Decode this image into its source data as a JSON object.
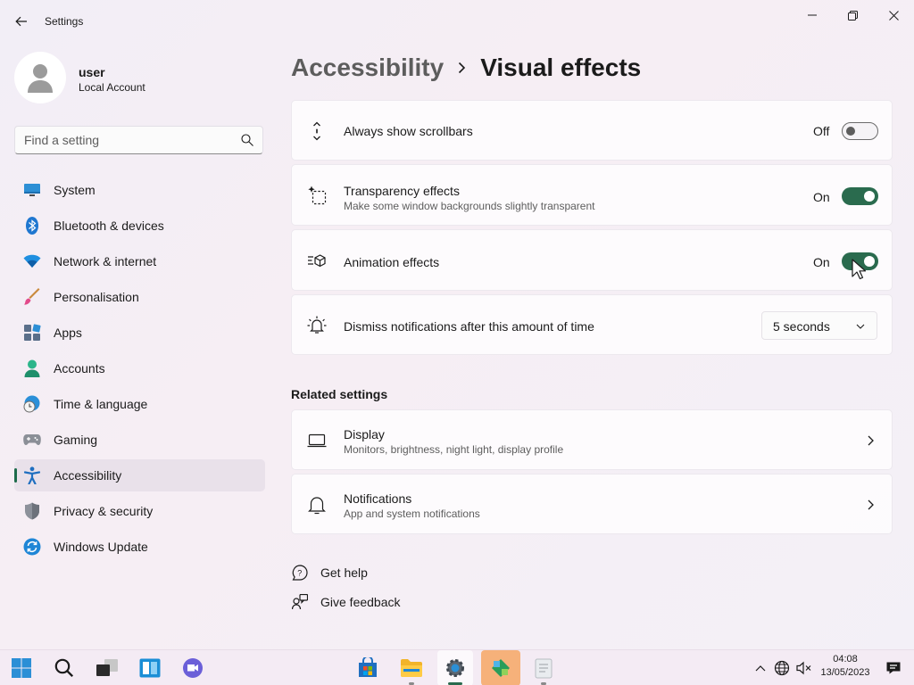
{
  "window": {
    "title": "Settings"
  },
  "profile": {
    "name": "user",
    "account_type": "Local Account"
  },
  "search": {
    "placeholder": "Find a setting"
  },
  "nav": {
    "items": [
      {
        "label": "System",
        "icon": "monitor-icon"
      },
      {
        "label": "Bluetooth & devices",
        "icon": "bluetooth-icon"
      },
      {
        "label": "Network & internet",
        "icon": "wifi-icon"
      },
      {
        "label": "Personalisation",
        "icon": "brush-icon"
      },
      {
        "label": "Apps",
        "icon": "apps-icon"
      },
      {
        "label": "Accounts",
        "icon": "person-icon"
      },
      {
        "label": "Time & language",
        "icon": "globe-clock-icon"
      },
      {
        "label": "Gaming",
        "icon": "gamepad-icon"
      },
      {
        "label": "Accessibility",
        "icon": "accessibility-icon",
        "selected": true
      },
      {
        "label": "Privacy & security",
        "icon": "shield-icon"
      },
      {
        "label": "Windows Update",
        "icon": "update-icon"
      }
    ]
  },
  "breadcrumb": {
    "parent": "Accessibility",
    "current": "Visual effects"
  },
  "settings": {
    "scrollbars": {
      "title": "Always show scrollbars",
      "state_label": "Off",
      "enabled": false
    },
    "transparency": {
      "title": "Transparency effects",
      "subtitle": "Make some window backgrounds slightly transparent",
      "state_label": "On",
      "enabled": true
    },
    "animation": {
      "title": "Animation effects",
      "state_label": "On",
      "enabled": true
    },
    "notifications_timeout": {
      "title": "Dismiss notifications after this amount of time",
      "selected": "5 seconds"
    }
  },
  "related": {
    "title": "Related settings",
    "items": [
      {
        "title": "Display",
        "subtitle": "Monitors, brightness, night light, display profile"
      },
      {
        "title": "Notifications",
        "subtitle": "App and system notifications"
      }
    ]
  },
  "help_links": {
    "help": "Get help",
    "feedback": "Give feedback"
  },
  "taskbar": {
    "time": "04:08",
    "date": "13/05/2023"
  },
  "colors": {
    "accent": "#2a6b4e",
    "active_app_highlight": "#f6b17a"
  }
}
